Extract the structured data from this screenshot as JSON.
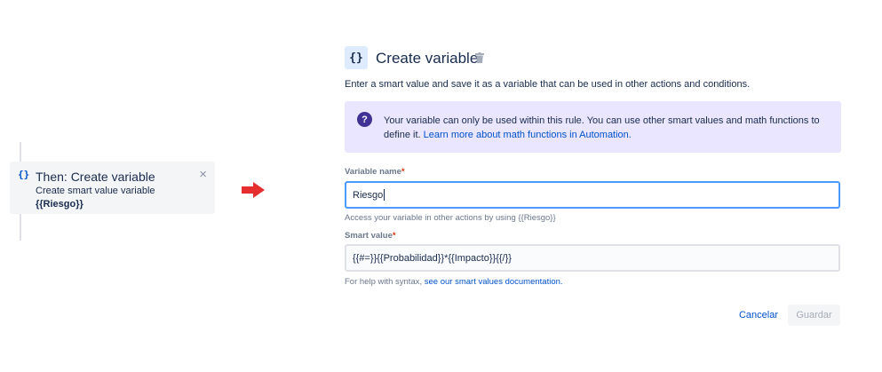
{
  "rule": {
    "icon": "{}",
    "title": "Then: Create variable",
    "close": "×",
    "subtitle": "Create smart value variable",
    "variable": "{{Riesgo}}"
  },
  "arrow_color": "#E62E2E",
  "panel": {
    "icon": "{}",
    "title": "Create variable",
    "description": "Enter a smart value and save it as a variable that can be used in other actions and conditions.",
    "info": {
      "icon": "?",
      "text": "Your variable can only be used within this rule. You can use other smart values and math functions to define it.",
      "link": "Learn more about math functions in Automation."
    },
    "variable_name": {
      "label": "Variable name",
      "required": "*",
      "value": "Riesgo",
      "help": "Access your variable in other actions by using {{Riesgo}}"
    },
    "smart_value": {
      "label": "Smart value",
      "required": "*",
      "value": "{{#=}}{{Probabilidad}}*{{Impacto}}{{/}}",
      "help": "For help with syntax,",
      "help_link": "see our smart values documentation."
    },
    "buttons": {
      "cancel": "Cancelar",
      "save": "Guardar"
    }
  },
  "colors": {
    "primary": "#0052CC",
    "info_bg": "#EAE6FF",
    "info_icon": "#403294",
    "focus_border": "#4C9AFF",
    "required": "#DE350B"
  }
}
